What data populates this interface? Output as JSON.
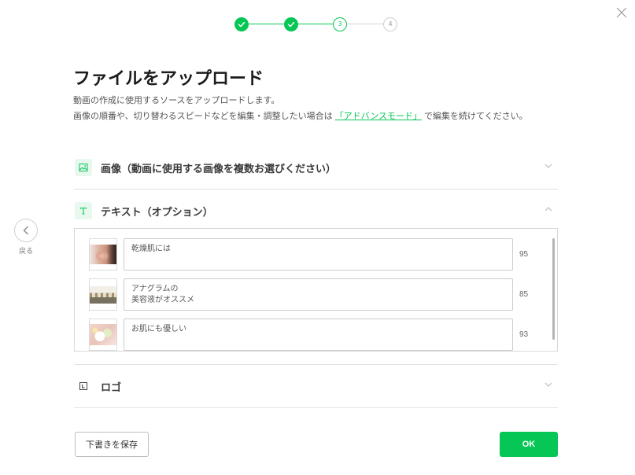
{
  "colors": {
    "accent": "#06c755",
    "accent_light": "#e8f8ee"
  },
  "window": {
    "close_icon": "close-icon"
  },
  "stepper": {
    "steps": [
      {
        "state": "done",
        "icon": "check-icon"
      },
      {
        "state": "done",
        "icon": "check-icon"
      },
      {
        "state": "current",
        "label": "3"
      },
      {
        "state": "upcoming",
        "label": "4"
      }
    ]
  },
  "header": {
    "title": "ファイルをアップロード",
    "line1": "動画の作成に使用するソースをアップロードします。",
    "line2_prefix": "画像の順番や、切り替わるスピードなどを編集・調整したい場合は",
    "advanced_mode_link": "「アドバンスモード」",
    "line2_suffix": "で編集を続けてください。"
  },
  "sections": [
    {
      "icon": "image-icon",
      "title": "画像（動画に使用する画像を複数お選びください）",
      "expanded": false
    },
    {
      "icon": "text-icon",
      "title": "テキスト（オプション）",
      "expanded": true,
      "items": [
        {
          "text": "乾燥肌には",
          "remaining": 95
        },
        {
          "text": "アナグラムの\n美容液がオススメ",
          "remaining": 85
        },
        {
          "text": "お肌にも優しい",
          "remaining": 93
        }
      ]
    },
    {
      "icon": "logo-icon",
      "title": "ロゴ",
      "expanded": false
    }
  ],
  "nav": {
    "back_label": "戻る",
    "back_icon": "chevron-left-icon"
  },
  "footer": {
    "save_draft_label": "下書きを保存",
    "ok_label": "OK"
  }
}
